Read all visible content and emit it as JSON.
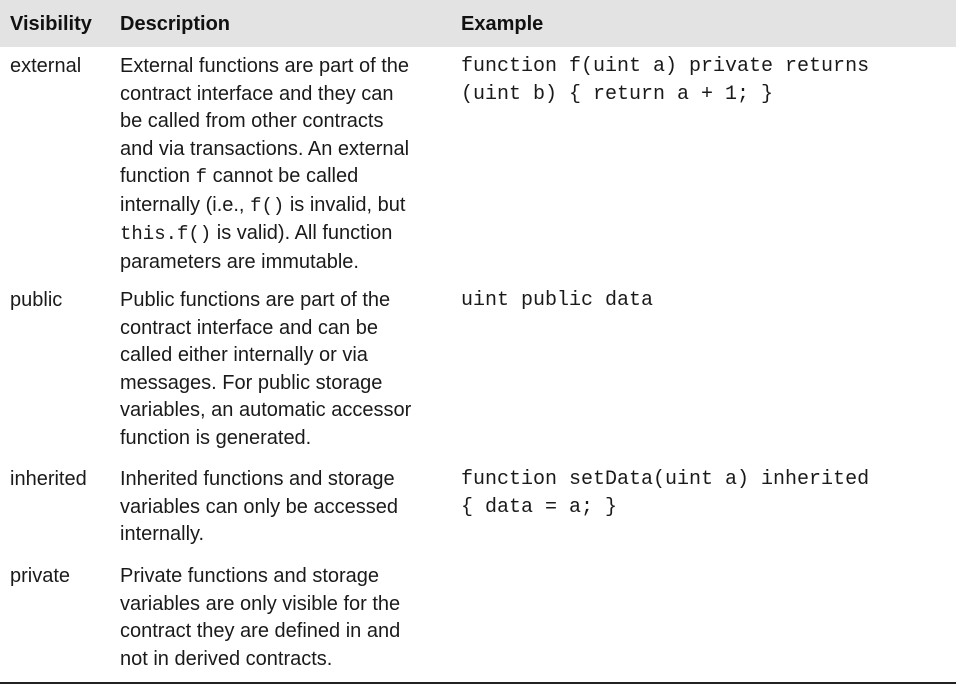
{
  "headers": {
    "visibility": "Visibility",
    "description": "Description",
    "example": "Example"
  },
  "rows": [
    {
      "visibility": "external",
      "description": {
        "l0": "External functions are part of the",
        "l1": "contract interface and they can",
        "l2": "be called from other contracts",
        "l3": "and via transactions. An external",
        "l4a": "function ",
        "l4b": "f",
        "l4c": " cannot be called",
        "l5a": "internally (i.e., ",
        "l5b": "f()",
        "l5c": " is invalid, but",
        "l6a": "this.f()",
        "l6b": " is valid). All function",
        "l7": "parameters are immutable."
      },
      "example": [
        "function f(uint a) private returns",
        "(uint b) { return a + 1; }"
      ]
    },
    {
      "visibility": "public",
      "description": [
        "Public functions are part of the",
        "contract interface and can be",
        "called either internally or via",
        "messages. For public storage",
        "variables, an automatic accessor",
        "function is generated."
      ],
      "example": [
        "uint public data"
      ]
    },
    {
      "visibility": "inherited",
      "description": [
        "Inherited functions and storage",
        "variables can only be accessed",
        "internally."
      ],
      "example": [
        "function setData(uint a) inherited",
        "{ data = a; }"
      ]
    },
    {
      "visibility": "private",
      "description": [
        "Private functions and storage",
        "variables are only visible for the",
        "contract they are defined in and",
        "not in derived contracts."
      ],
      "example": []
    }
  ]
}
